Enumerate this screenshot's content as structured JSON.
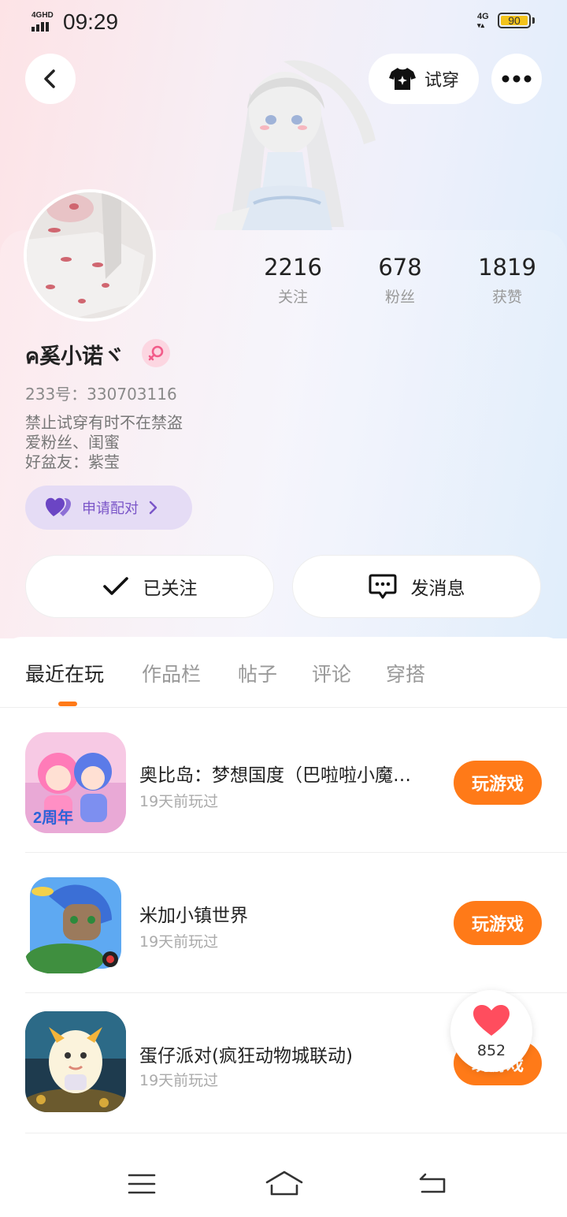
{
  "status_bar": {
    "signal_label": "4GHD",
    "time": "09:29",
    "network": "4G",
    "battery": "90"
  },
  "header": {
    "try_on_label": "试穿"
  },
  "profile": {
    "stats": [
      {
        "value": "2216",
        "label": "关注"
      },
      {
        "value": "678",
        "label": "粉丝"
      },
      {
        "value": "1819",
        "label": "获赞"
      }
    ],
    "name": "ค奚小诺ヾ",
    "uid": "233号：330703116",
    "bio": [
      "禁止试穿有时不在禁盗",
      "爱粉丝、闺蜜",
      "好盆友：紫莹"
    ],
    "pair_label": "申请配对",
    "follow_label": "已关注",
    "message_label": "发消息"
  },
  "tabs": [
    "最近在玩",
    "作品栏",
    "帖子",
    "评论",
    "穿搭"
  ],
  "games": [
    {
      "title": "奥比岛：梦想国度（巴啦啦小魔…",
      "subtitle": "19天前玩过",
      "button": "玩游戏",
      "badge": "2周年"
    },
    {
      "title": "米加小镇世界",
      "subtitle": "19天前玩过",
      "button": "玩游戏"
    },
    {
      "title": "蛋仔派对(疯狂动物城联动)",
      "subtitle": "19天前玩过",
      "button": "玩游戏"
    }
  ],
  "like_widget": {
    "count": "852"
  },
  "colors": {
    "accent": "#ff7a18",
    "pair_bg": "#e5dcf5",
    "pair_text": "#7a55c8",
    "heart": "#ff4d5e"
  }
}
